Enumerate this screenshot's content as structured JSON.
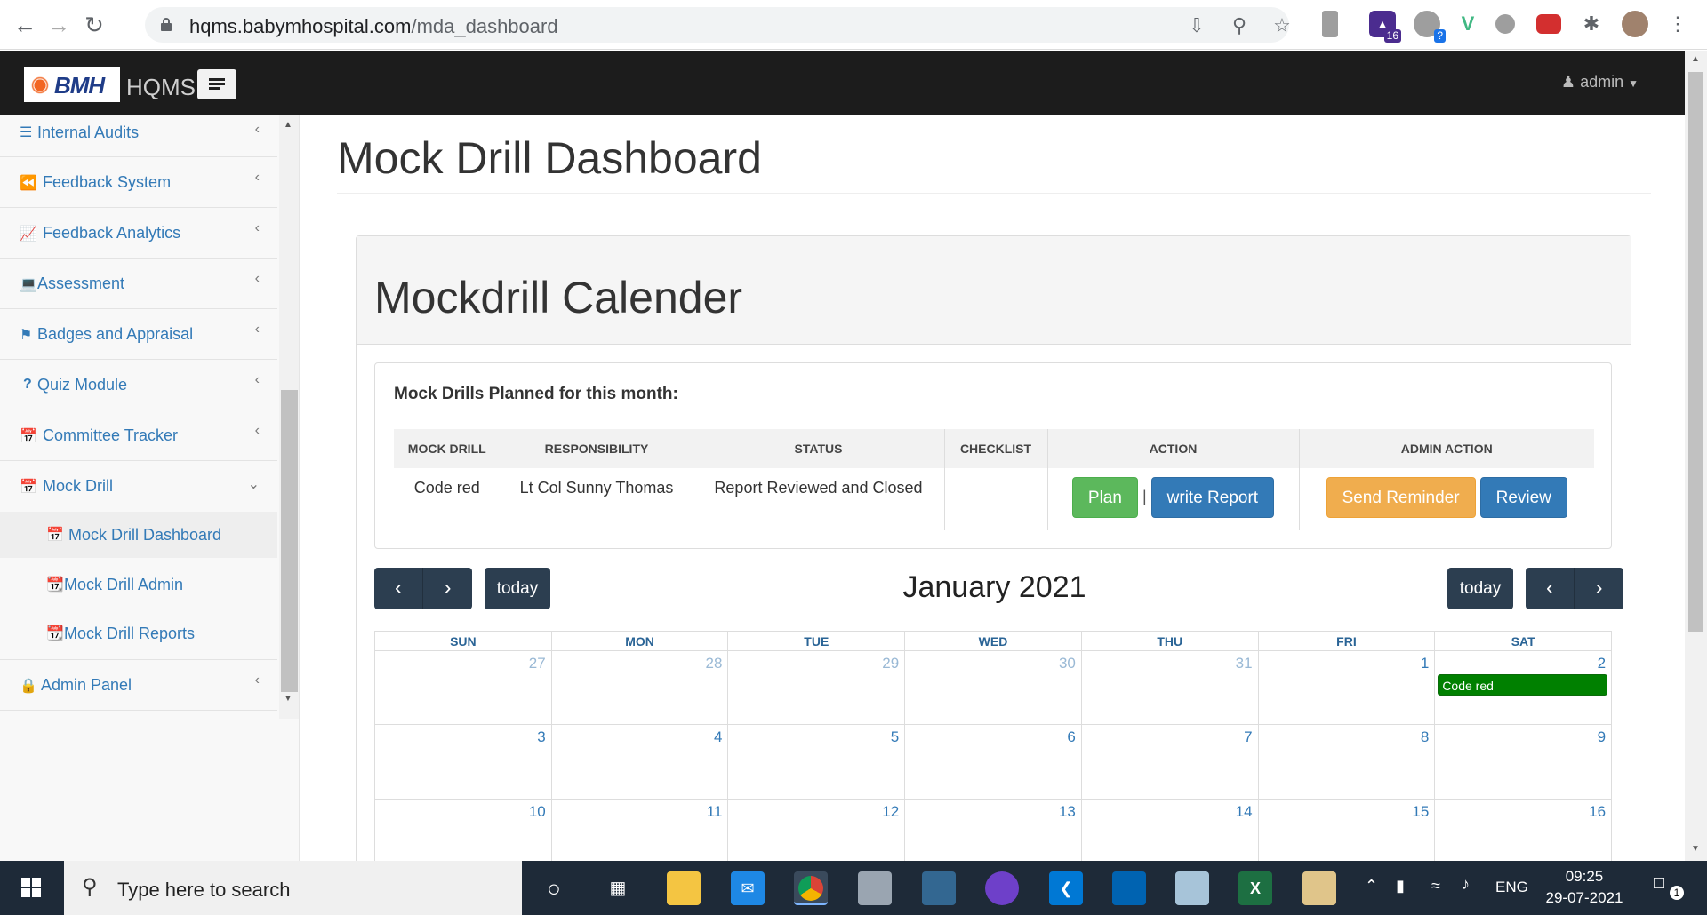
{
  "browser": {
    "url_host": "hqms.babymhospital.com",
    "url_path": "/mda_dashboard",
    "ext_badge_1": "16",
    "ext_badge_2": "?"
  },
  "header": {
    "logo_text": "BMH",
    "app_name": "HQMS",
    "user": "admin"
  },
  "sidebar": {
    "items": [
      {
        "label": "Internal Audits",
        "icon": "list-icon"
      },
      {
        "label": "Feedback System",
        "icon": "backward-icon"
      },
      {
        "label": "Feedback Analytics",
        "icon": "line-chart-icon"
      },
      {
        "label": "Assessment",
        "icon": "laptop-icon"
      },
      {
        "label": "Badges and Appraisal",
        "icon": "tag-icon"
      },
      {
        "label": "Quiz Module",
        "icon": "question-icon"
      },
      {
        "label": "Committee Tracker",
        "icon": "calendar-icon"
      },
      {
        "label": "Mock Drill",
        "icon": "calendar-icon"
      }
    ],
    "sub_items": [
      {
        "label": "Mock Drill Dashboard"
      },
      {
        "label": "Mock Drill Admin"
      },
      {
        "label": "Mock Drill Reports"
      }
    ],
    "admin": {
      "label": "Admin Panel",
      "icon": "lock-icon"
    }
  },
  "main": {
    "page_title": "Mock Drill Dashboard",
    "panel_title": "Mockdrill Calender",
    "plan_heading": "Mock Drills Planned for this month:",
    "table": {
      "headers": [
        "MOCK DRILL",
        "RESPONSIBILITY",
        "STATUS",
        "CHECKLIST",
        "ACTION",
        "ADMIN ACTION"
      ],
      "row": {
        "mock_drill": "Code red",
        "responsibility": "Lt Col Sunny Thomas",
        "status": "Report Reviewed and Closed",
        "checklist": "",
        "action_plan": "Plan",
        "action_sep": "|",
        "action_report": "write Report",
        "admin_reminder": "Send Reminder",
        "admin_review": "Review"
      }
    }
  },
  "calendar": {
    "title": "January 2021",
    "today_label": "today",
    "days": [
      "SUN",
      "MON",
      "TUE",
      "WED",
      "THU",
      "FRI",
      "SAT"
    ],
    "weeks": [
      [
        "27",
        "28",
        "29",
        "30",
        "31",
        "1",
        "2"
      ],
      [
        "3",
        "4",
        "5",
        "6",
        "7",
        "8",
        "9"
      ],
      [
        "10",
        "11",
        "12",
        "13",
        "14",
        "15",
        "16"
      ]
    ],
    "event": {
      "label": "Code red",
      "color": "#008000"
    }
  },
  "taskbar": {
    "search_placeholder": "Type here to search",
    "lang": "ENG",
    "time": "09:25",
    "date": "29-07-2021",
    "notif_count": "1"
  },
  "colors": {
    "link": "#337ab7",
    "header_bg": "#1c1c1c",
    "cal_button": "#2c3e50",
    "btn_green": "#5cb85c",
    "btn_orange": "#f0ad4e"
  }
}
